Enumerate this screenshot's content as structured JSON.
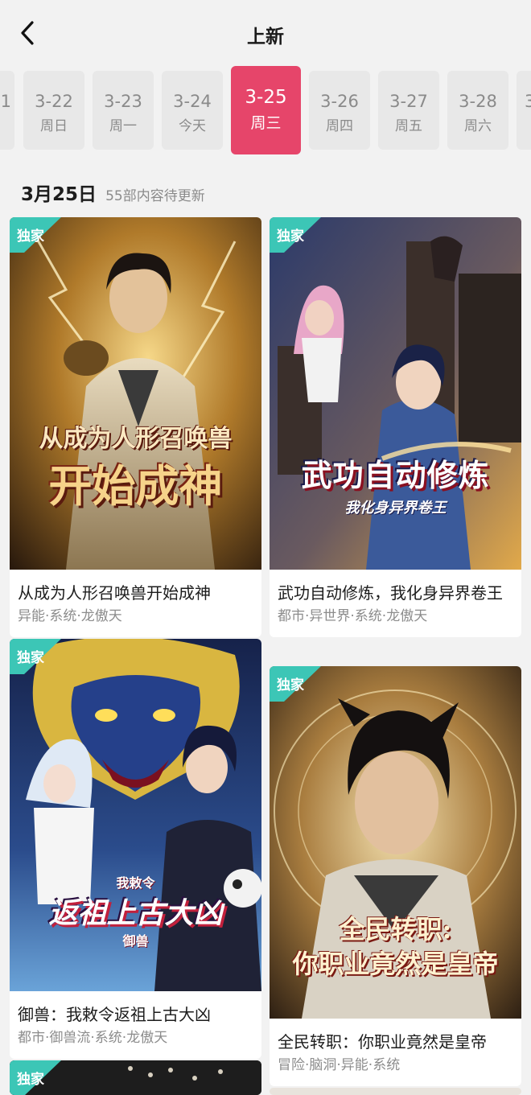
{
  "header": {
    "title": "上新"
  },
  "date_tabs": [
    {
      "date": "1",
      "weekday": ""
    },
    {
      "date": "3-22",
      "weekday": "周日"
    },
    {
      "date": "3-23",
      "weekday": "周一"
    },
    {
      "date": "3-24",
      "weekday": "今天"
    },
    {
      "date": "3-25",
      "weekday": "周三",
      "active": true
    },
    {
      "date": "3-26",
      "weekday": "周四"
    },
    {
      "date": "3-27",
      "weekday": "周五"
    },
    {
      "date": "3-28",
      "weekday": "周六"
    },
    {
      "date": "3",
      "weekday": ""
    }
  ],
  "section": {
    "date": "3月25日",
    "count_text": "55部内容待更新"
  },
  "cards": [
    {
      "badge": "独家",
      "cover_text": [
        "从成为人形召唤兽",
        "开始成神"
      ],
      "title": "从成为人形召唤兽开始成神",
      "tags": "异能·系统·龙傲天"
    },
    {
      "badge": "独家",
      "cover_text": [
        "武功自动修炼",
        "我化身异界卷王"
      ],
      "title": "武功自动修炼，我化身异界卷王",
      "tags": "都市·异世界·系统·龙傲天"
    },
    {
      "badge": "独家",
      "cover_text": [
        "我敕令",
        "返祖上古大凶",
        "御兽"
      ],
      "title": "御兽：我敕令返祖上古大凶",
      "tags": "都市·御兽流·系统·龙傲天"
    },
    {
      "badge": "独家",
      "cover_text": [
        "全民转职:",
        "你职业竟然是皇帝"
      ],
      "title": "全民转职：你职业竟然是皇帝",
      "tags": "冒险·脑洞·异能·系统"
    },
    {
      "badge": "独家"
    }
  ],
  "colors": {
    "accent": "#e6456a",
    "badge": "#3cc6b6",
    "background": "#f2f2f2"
  }
}
